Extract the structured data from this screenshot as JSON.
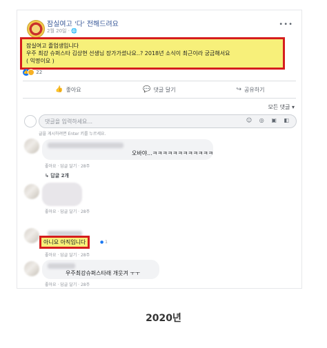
{
  "post": {
    "page_name": "잠실여고 '다' 전해드려요",
    "time": "2월 20일",
    "text_lines": [
      "잠실여고 졸업생입니다",
      "우주 최강 슈퍼스타 김상현 선생님 장가가셨나요..? 2018년 소식이 최근이라 궁금해서요",
      "( 익명이요 )"
    ],
    "reaction_count": "22"
  },
  "actions": {
    "like": "좋아요",
    "comment": "댓글 달기",
    "share": "공유하기"
  },
  "sort_label": "모든 댓글",
  "comment_input": {
    "placeholder": "댓글을 입력하세요...",
    "hint": "글을 게시하려면 Enter 키를 누르세요."
  },
  "comments": [
    {
      "text": "오바야...ㅋㅋㅋㅋㅋㅋㅋㅋㅋㅋㅋㅋ",
      "meta": "좋아요 · 답글 달기 · 28주",
      "replies": "↳ 답글 2개"
    },
    {
      "text": "",
      "meta": "좋아요 · 답글 달기 · 28주"
    },
    {
      "text": "아니요 아직입니다",
      "meta": "좋아요 · 답글 달기 · 28주",
      "reaction": "1"
    },
    {
      "text": "우주최강슈퍼스타래 개웃겨 ㅜㅜ",
      "meta": "좋아요 · 답글 달기 · 28주"
    }
  ],
  "caption": "2020년"
}
